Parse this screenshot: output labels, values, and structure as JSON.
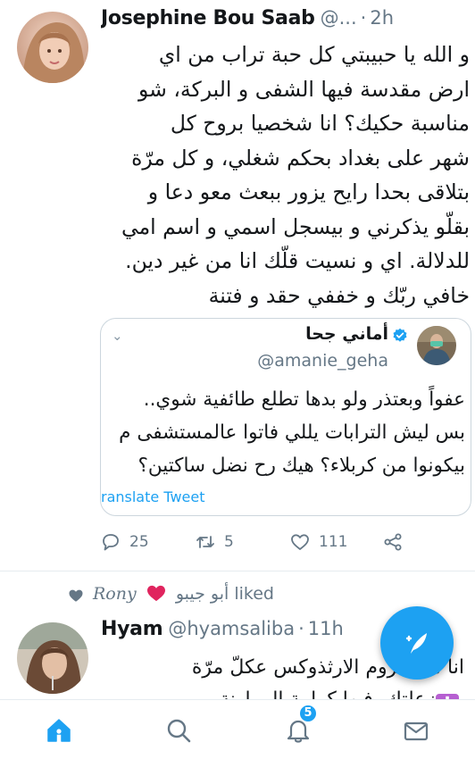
{
  "tweet": {
    "author_name": "Josephine Bou Saab",
    "handle": "@...",
    "separator": "·",
    "time": "2h",
    "text_lines": [
      "و الله يا حبيبتي كل حبة تراب من اي",
      "ارض مقدسة فيها الشفى و البركة، شو",
      "مناسبة حكيك؟ انا شخصيا بروح كل",
      "شهر على بغداد بحكم شغلي، و كل مرّة",
      "بتلاقى بحدا رايح يزور ببعث معو دعا و",
      "بقلّو يذكرني و بيسجل اسمي و اسم امي",
      "للدلالة. اي و نسيت قلّك انا من غير دين.",
      "خافي ربّك و خففي حقد و فتنة"
    ],
    "quoted": {
      "author_name": "أماني جحا",
      "handle": "@amanie_geha",
      "text_lines": [
        "عفواً وبعتذر ولو بدها تطلع طائفية شوي..",
        "بس ليش الترابات يللي فاتوا عالمستشفى م",
        "بيكونوا من كربلاء؟ هيك رح نضل ساكتين؟"
      ],
      "translate_label": "ranslate Tweet"
    },
    "actions": {
      "replies": "25",
      "retweets": "5",
      "likes": "111"
    }
  },
  "liked_notice": {
    "liker_name": "Rony",
    "liker_arabic": "أبو جيبو",
    "verb": "liked"
  },
  "tweet2": {
    "author_name": "Hyam",
    "handle": "@hyamsaliba",
    "separator": "·",
    "time": "11h",
    "text_lines": [
      "انا من الروم الارثذوكس عكلّ مرّة",
      "زعلتك. فيها كرامة الموارنة"
    ]
  },
  "nav": {
    "notifications_badge": "5"
  },
  "colors": {
    "accent": "#1da1f2",
    "secondary_text": "#657786",
    "heart_red": "#e0245e"
  },
  "icons": {
    "verified": "verified-badge-icon",
    "reply": "reply-icon",
    "retweet": "retweet-icon",
    "like": "heart-icon",
    "share": "share-icon",
    "compose": "compose-tweet-icon",
    "home": "home-icon",
    "search": "search-icon",
    "notifications": "bell-icon",
    "messages": "mail-icon"
  }
}
